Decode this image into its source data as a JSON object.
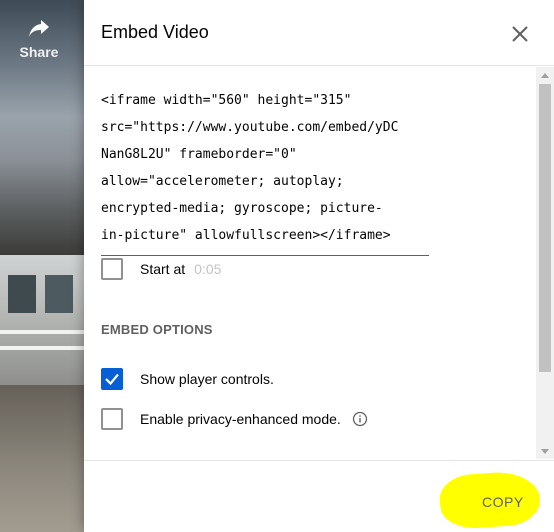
{
  "background": {
    "share_label": "Share",
    "share_icon": "share-arrow-icon"
  },
  "dialog": {
    "title": "Embed Video",
    "close_icon": "close-icon",
    "embed_code_lines": [
      "<iframe width=\"560\" height=\"315\"",
      "src=\"https://www.youtube.com/embed/yDC",
      "NanG8L2U\" frameborder=\"0\"",
      "allow=\"accelerometer; autoplay;",
      "encrypted-media; gyroscope; picture-",
      "in-picture\" allowfullscreen></iframe>"
    ],
    "start_at": {
      "label": "Start at",
      "time": "0:05",
      "checked": false
    },
    "embed_options_title": "EMBED OPTIONS",
    "options": [
      {
        "label": "Show player controls.",
        "checked": true
      },
      {
        "label": "Enable privacy-enhanced mode.",
        "checked": false,
        "info_icon": "info-icon"
      }
    ],
    "copy_label": "COPY",
    "accent_color": "#065fd4",
    "highlight_color": "#ffff00"
  }
}
